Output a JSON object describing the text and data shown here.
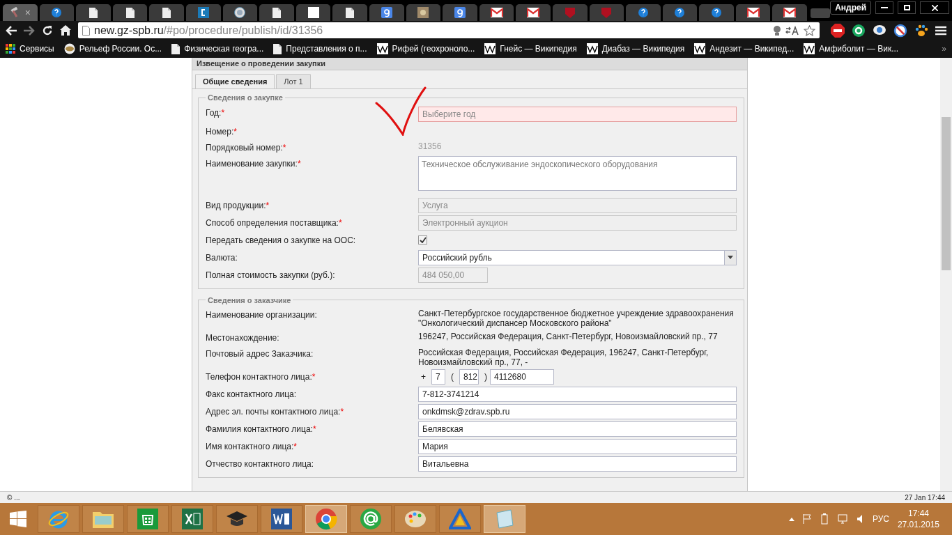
{
  "browser": {
    "tabs": [
      {
        "kind": "hammer",
        "selected": true,
        "close": "×"
      },
      {
        "kind": "help",
        "selected": false
      },
      {
        "kind": "page",
        "selected": false
      },
      {
        "kind": "page",
        "selected": false
      },
      {
        "kind": "page",
        "selected": false
      },
      {
        "kind": "square-c",
        "selected": false
      },
      {
        "kind": "seal",
        "selected": false
      },
      {
        "kind": "page",
        "selected": false
      },
      {
        "kind": "blank",
        "selected": false
      },
      {
        "kind": "page",
        "selected": false
      },
      {
        "kind": "google",
        "selected": false
      },
      {
        "kind": "photo",
        "selected": false
      },
      {
        "kind": "google",
        "selected": false
      },
      {
        "kind": "mail",
        "selected": false
      },
      {
        "kind": "mail",
        "selected": false
      },
      {
        "kind": "shield",
        "selected": false
      },
      {
        "kind": "shield",
        "selected": false
      },
      {
        "kind": "help",
        "selected": false
      },
      {
        "kind": "help",
        "selected": false
      },
      {
        "kind": "help",
        "selected": false
      },
      {
        "kind": "mail",
        "selected": false
      },
      {
        "kind": "mail",
        "selected": false
      }
    ],
    "profile": "Андрей",
    "url_host": "new.gz-spb.ru",
    "url_path": "/#po/procedure/publish/id/31356",
    "bookmarks": [
      {
        "kind": "apps",
        "label": "Сервисы"
      },
      {
        "kind": "globe",
        "label": "Рельеф России. Ос..."
      },
      {
        "kind": "page",
        "label": "Физическая геогра..."
      },
      {
        "kind": "page",
        "label": "Представления о п..."
      },
      {
        "kind": "wiki",
        "label": "Рифей (геохроноло..."
      },
      {
        "kind": "wiki",
        "label": "Гнейс — Википедия"
      },
      {
        "kind": "wiki",
        "label": "Диабаз — Википедия"
      },
      {
        "kind": "wiki",
        "label": "Андезит — Википед..."
      },
      {
        "kind": "wiki",
        "label": "Амфиболит — Вик..."
      }
    ],
    "bookmarks_more": "»"
  },
  "panel": {
    "title": "Извещение о проведении закупки",
    "tabs": [
      {
        "label": "Общие сведения",
        "selected": true
      },
      {
        "label": "Лот 1",
        "selected": false
      }
    ],
    "sections": [
      {
        "title": "Сведения о закупке",
        "fields": [
          {
            "kind": "select",
            "label": "Год:",
            "required_mark": "*",
            "placeholder": "Выберите год",
            "invalid": true
          },
          {
            "kind": "static",
            "label": "Номер:",
            "required_mark": "*"
          },
          {
            "kind": "static",
            "label": "Порядковый номер:",
            "required_mark": "*",
            "value": "31356",
            "disabled": true
          },
          {
            "kind": "textarea",
            "label": "Наименование закупки:",
            "required_mark": "*",
            "value": "Техническое обслуживание эндоскопического оборудования"
          },
          {
            "kind": "readonly",
            "label": "Вид продукции:",
            "required_mark": "*",
            "value": "Услуга"
          },
          {
            "kind": "readonly",
            "label": "Способ определения поставщика:",
            "required_mark": "*",
            "value": "Электронный аукцион"
          },
          {
            "kind": "checkbox",
            "label": "Передать сведения о закупке на ООС:",
            "checked": true
          },
          {
            "kind": "dropdown",
            "label": "Валюта:",
            "value": "Российский рубль"
          },
          {
            "kind": "amount",
            "label": "Полная стоимость закупки (руб.):",
            "value": "484 050,00"
          }
        ]
      },
      {
        "title": "Сведения о заказчике",
        "fields": [
          {
            "kind": "static",
            "label": "Наименование организации:",
            "value": "Санкт-Петербургское государственное бюджетное учреждение здравоохранения \"Онкологический диспансер Московского района\"",
            "disabled": false
          },
          {
            "kind": "static",
            "label": "Местонахождение:",
            "value": "196247, Российская Федерация, Санкт-Петербург, Новоизмайловский пр., 77",
            "disabled": false
          },
          {
            "kind": "static",
            "label": "Почтовый адрес Заказчика:",
            "value": "Российская Федерация, Российская Федерация, 196247, Санкт-Петербург, Новоизмайловский пр., 77, -",
            "disabled": false
          },
          {
            "kind": "phone",
            "label": "Телефон контактного лица:",
            "required_mark": "*",
            "plus": "+",
            "country": "7",
            "open": "(",
            "area": "812",
            "close": ")",
            "number": "4112680"
          },
          {
            "kind": "input",
            "label": "Факс контактного лица:",
            "value": "7-812-3741214"
          },
          {
            "kind": "input",
            "label": "Адрес эл. почты контактного лица:",
            "required_mark": "*",
            "value": "onkdmsk@zdrav.spb.ru"
          },
          {
            "kind": "input",
            "label": "Фамилия контактного лица:",
            "required_mark": "*",
            "value": "Белявская"
          },
          {
            "kind": "input",
            "label": "Имя контактного лица:",
            "required_mark": "*",
            "value": "Мария"
          },
          {
            "kind": "input",
            "label": "Отчество контактного лица:",
            "value": "Витальевна"
          }
        ]
      }
    ]
  },
  "status_bar": {
    "left": "© ...",
    "right": "27 Jan 17:44"
  },
  "taskbar": {
    "apps": [
      {
        "kind": "ie",
        "selected": false
      },
      {
        "kind": "folder",
        "selected": false
      },
      {
        "kind": "store",
        "selected": false
      },
      {
        "kind": "excel",
        "selected": false
      },
      {
        "kind": "cap",
        "selected": false
      },
      {
        "kind": "word",
        "selected": false
      },
      {
        "kind": "chrome",
        "selected": true
      },
      {
        "kind": "at",
        "selected": false
      },
      {
        "kind": "palette",
        "selected": false
      },
      {
        "kind": "triangle",
        "selected": false
      },
      {
        "kind": "notepad",
        "selected": true
      }
    ],
    "lang": "РУС",
    "time": "17:44",
    "date": "27.01.2015"
  }
}
